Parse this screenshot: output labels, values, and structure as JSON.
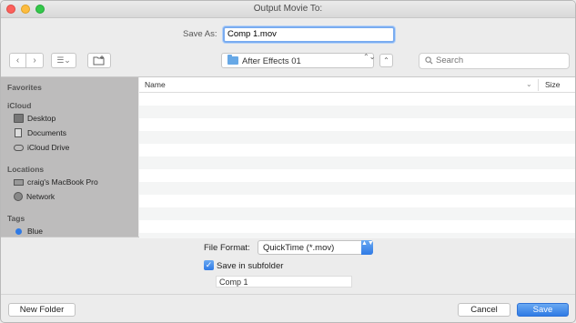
{
  "window": {
    "title": "Output Movie To:"
  },
  "save_as": {
    "label": "Save As:",
    "value": "Comp 1.mov"
  },
  "toolbar": {
    "back_glyph": "‹",
    "forward_glyph": "›",
    "view_glyph": "☰⌄",
    "location": "After Effects 01",
    "location_updown": "⌃⌄",
    "expand_glyph": "⌃",
    "search_placeholder": "Search"
  },
  "sidebar": {
    "sections": [
      {
        "title": "Favorites",
        "items": []
      },
      {
        "title": "iCloud",
        "items": [
          {
            "label": "Desktop",
            "icon": "desktop-icon"
          },
          {
            "label": "Documents",
            "icon": "document-icon"
          },
          {
            "label": "iCloud Drive",
            "icon": "cloud-icon"
          }
        ]
      },
      {
        "title": "Locations",
        "items": [
          {
            "label": "craig's MacBook Pro",
            "icon": "laptop-icon"
          },
          {
            "label": "Network",
            "icon": "network-icon"
          }
        ]
      },
      {
        "title": "Tags",
        "items": [
          {
            "label": "Blue",
            "icon": "tag-dot-icon",
            "color": "#2f7ae5"
          }
        ]
      }
    ]
  },
  "file_list": {
    "columns": {
      "name": "Name",
      "sort_glyph": "⌄",
      "size": "Size"
    }
  },
  "options": {
    "file_format_label": "File Format:",
    "file_format_value": "QuickTime (*.mov)",
    "select_arrows": "▲▼",
    "subfolder_checked": true,
    "checkmark": "✓",
    "subfolder_label": "Save in subfolder",
    "subfolder_name": "Comp 1"
  },
  "buttons": {
    "new_folder": "New Folder",
    "cancel": "Cancel",
    "save": "Save"
  },
  "colors": {
    "accent": "#2f7ae5",
    "sidebar_bg": "#bdbcbc"
  }
}
